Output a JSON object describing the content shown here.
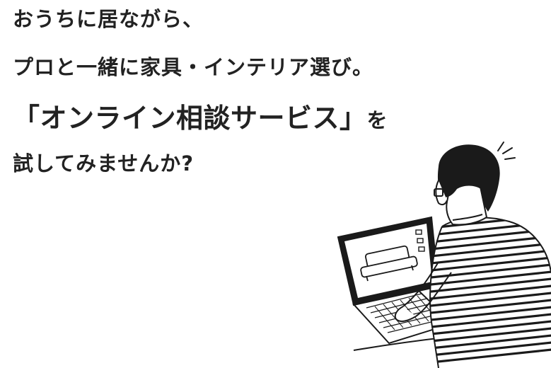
{
  "headline": {
    "line1": "おうちに居ながら、",
    "line2": "プロと一緒に家具・インテリア選び。",
    "line3_main": "「オンライン相談サービス」",
    "line3_tail": "を",
    "line4": "試してみませんか?"
  },
  "illustration": {
    "icon": "person-at-laptop-illustration",
    "screen_content": "sofa"
  },
  "colors": {
    "text": "#222222",
    "background": "#ffffff",
    "ink": "#1a1a1a"
  }
}
